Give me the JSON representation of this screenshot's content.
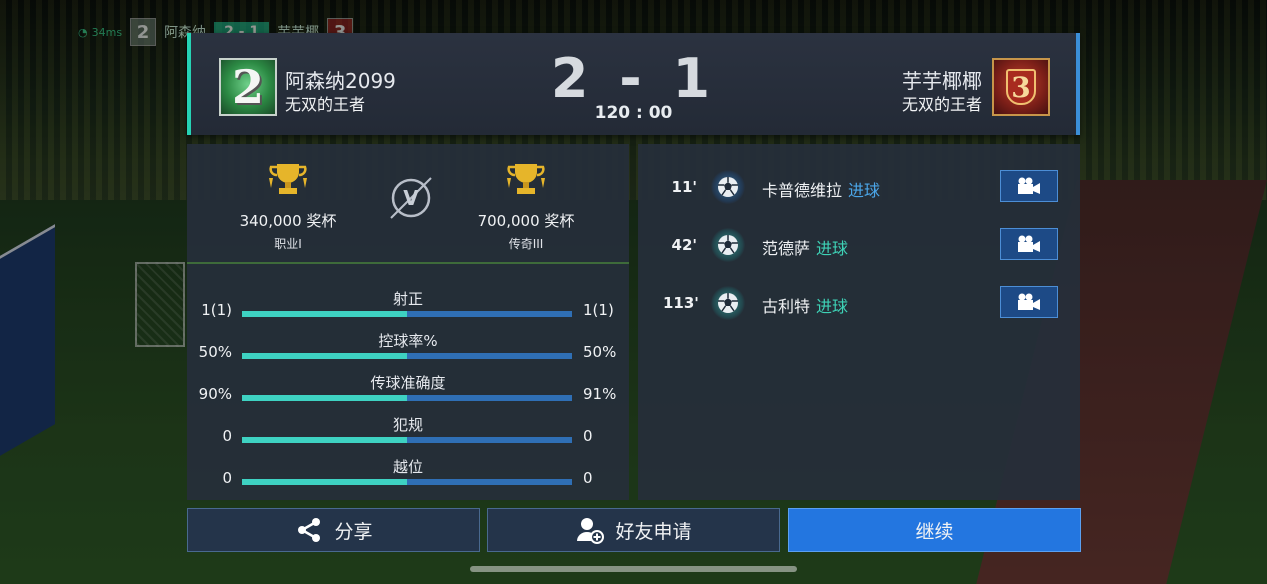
{
  "hud": {
    "ping": "34ms",
    "home_rank": "2",
    "home_name": "阿森纳",
    "score": "2 - 1",
    "away_name": "芋芋椰",
    "away_rank": "3"
  },
  "header": {
    "home": {
      "rank": "2",
      "name": "阿森纳2099",
      "title": "无双的王者"
    },
    "away": {
      "rank": "3",
      "name": "芋芋椰椰",
      "title": "无双的王者"
    },
    "score": "2 - 1",
    "time": "120 : 00"
  },
  "trophies": {
    "home": {
      "count": "340,000 奖杯",
      "rank": "职业I"
    },
    "away": {
      "count": "700,000 奖杯",
      "rank": "传奇III"
    },
    "vs_label": "V"
  },
  "stats": [
    {
      "label": "射正",
      "home": "1(1)",
      "away": "1(1)",
      "home_share": 0.5
    },
    {
      "label": "控球率%",
      "home": "50%",
      "away": "50%",
      "home_share": 0.5
    },
    {
      "label": "传球准确度",
      "home": "90%",
      "away": "91%",
      "home_share": 0.5
    },
    {
      "label": "犯规",
      "home": "0",
      "away": "0",
      "home_share": 0.5
    },
    {
      "label": "越位",
      "home": "0",
      "away": "0",
      "home_share": 0.5
    }
  ],
  "events": [
    {
      "minute": "11'",
      "player": "卡普德维拉",
      "type": "进球",
      "team": "home"
    },
    {
      "minute": "42'",
      "player": "范德萨",
      "type": "进球",
      "team": "away"
    },
    {
      "minute": "113'",
      "player": "古利特",
      "type": "进球",
      "team": "away"
    }
  ],
  "buttons": {
    "share": "分享",
    "friend": "好友申请",
    "continue": "继续"
  },
  "colors": {
    "home_accent": "#3ed2c2",
    "away_accent": "#2f6fb5",
    "continue_button": "#2376e0"
  }
}
